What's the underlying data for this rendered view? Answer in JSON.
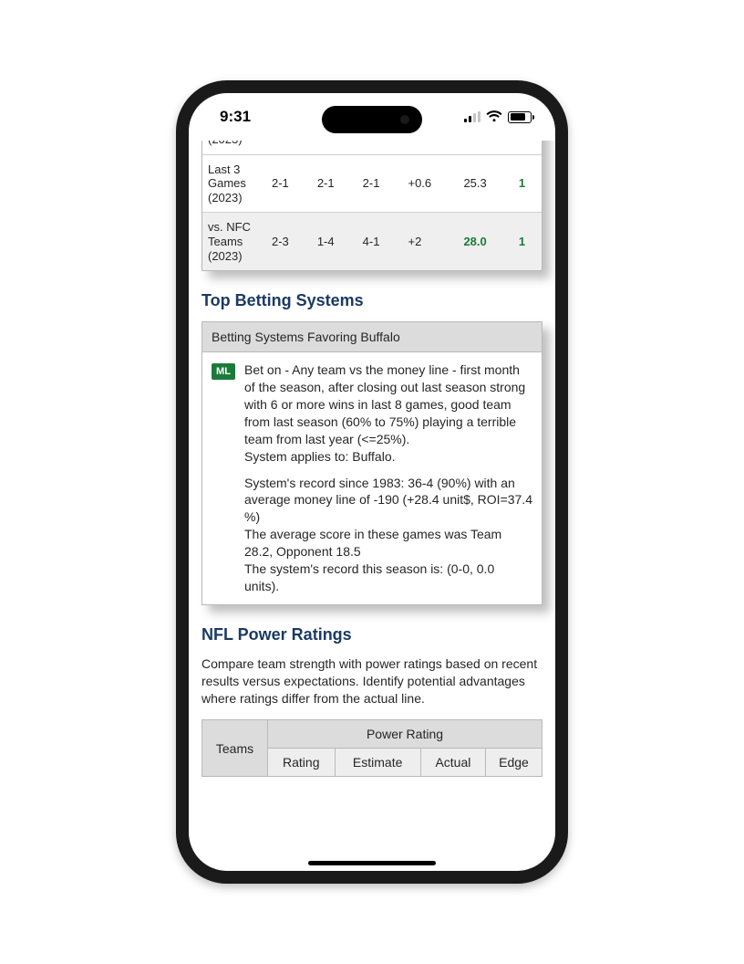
{
  "status": {
    "time": "9:31"
  },
  "stats": {
    "rows": [
      {
        "label": "(2023)",
        "c1": "",
        "c2": "",
        "c3": "",
        "c4": "",
        "c5": "",
        "c6": "",
        "truncated": true
      },
      {
        "label": "Last 3 Games (2023)",
        "c1": "2-1",
        "c2": "2-1",
        "c3": "2-1",
        "c4": "+0.6",
        "c5": "25.3",
        "c6": "1"
      },
      {
        "label": "vs. NFC Teams (2023)",
        "c1": "2-3",
        "c2": "1-4",
        "c3": "4-1",
        "c4": "+2",
        "c5": "28.0",
        "c5_strong": true,
        "c6": "1"
      }
    ]
  },
  "systems": {
    "heading": "Top Betting Systems",
    "panel_title": "Betting Systems Favoring Buffalo",
    "badge": "ML",
    "p1": "Bet on - Any team vs the money line - first month of the season, after closing out last season strong with 6 or more wins in last 8 games, good team from last season (60% to 75%) playing a terrible team from last year (<=25%).",
    "p2": "System applies to: Buffalo.",
    "p3": "System's record since 1983: 36-4 (90%) with an average money line of -190  (+28.4 unit$, ROI=37.4 %)",
    "p4": "The average score in these games was Team 28.2, Opponent 18.5",
    "p5": "The system's record this season is: (0-0, 0.0 units)."
  },
  "power": {
    "heading": "NFL Power Ratings",
    "intro": "Compare team strength with power ratings based on recent results versus expectations. Identify potential advantages where ratings differ from the actual line.",
    "merged_header": "Power Rating",
    "cols": {
      "teams": "Teams",
      "rating": "Rating",
      "estimate": "Estimate",
      "actual": "Actual",
      "edge": "Edge"
    }
  }
}
